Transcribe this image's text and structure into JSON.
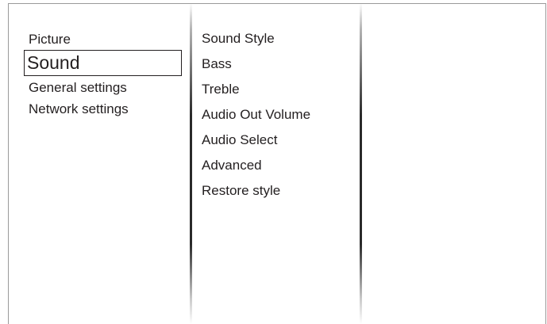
{
  "main_menu": {
    "items": [
      {
        "label": "Picture",
        "selected": false
      },
      {
        "label": "Sound",
        "selected": true
      },
      {
        "label": "General settings",
        "selected": false
      },
      {
        "label": "Network settings",
        "selected": false
      }
    ]
  },
  "sub_menu": {
    "items": [
      {
        "label": "Sound Style"
      },
      {
        "label": "Bass"
      },
      {
        "label": "Treble"
      },
      {
        "label": "Audio Out Volume"
      },
      {
        "label": "Audio Select"
      },
      {
        "label": "Advanced"
      },
      {
        "label": "Restore style"
      }
    ]
  },
  "colors": {
    "text": "#231f20",
    "background": "#ffffff",
    "frame": "#9a9a9a"
  }
}
